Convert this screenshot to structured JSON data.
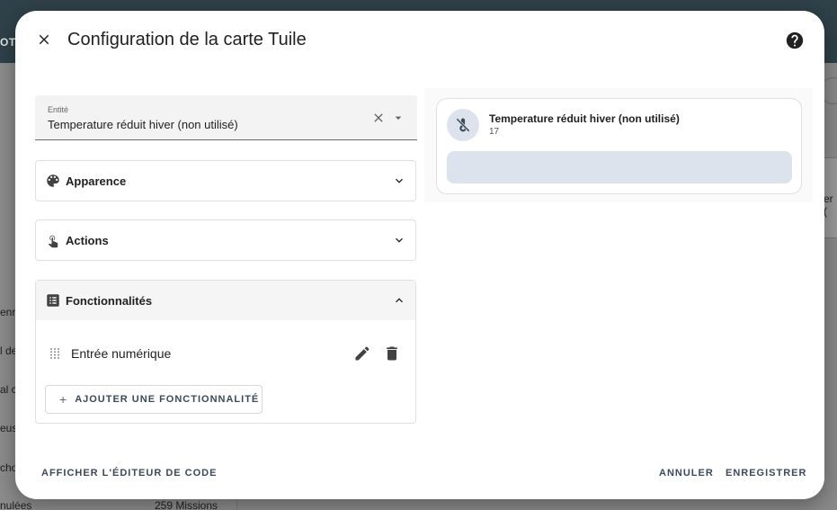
{
  "background": {
    "header_text": "OTE",
    "sidebar_items": [
      "enn",
      "l de",
      "al c",
      "eus",
      "cho",
      "nulées"
    ],
    "missions_count": "259 Missions",
    "right_text": "er ("
  },
  "dialog": {
    "title": "Configuration de la carte Tuile",
    "close_icon": "close-icon",
    "help_icon": "help-circle-icon"
  },
  "entity": {
    "label": "Entité",
    "value": "Temperature réduit hiver (non utilisé)"
  },
  "panels": {
    "appearance": {
      "label": "Apparence",
      "icon": "palette-icon"
    },
    "actions": {
      "label": "Actions",
      "icon": "gesture-tap-icon"
    },
    "features": {
      "label": "Fonctionnalités",
      "icon": "list-box-icon",
      "items": [
        {
          "label": "Entrée numérique"
        }
      ],
      "add_label": "AJOUTER UNE FONCTIONNALITÉ"
    }
  },
  "preview": {
    "name": "Temperature réduit hiver (non utilisé)",
    "state": "17",
    "icon": "thermometer-off-icon"
  },
  "footer": {
    "code_editor": "AFFICHER L'ÉDITEUR DE CODE",
    "cancel": "ANNULER",
    "save": "ENREGISTRER"
  },
  "colors": {
    "accent": "#3a4a5c",
    "tile_bg": "#dde3ec",
    "header_bg": "#2f4149"
  }
}
